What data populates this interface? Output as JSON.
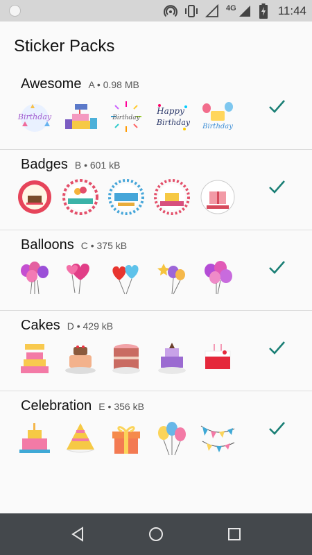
{
  "status_bar": {
    "time": "11:44",
    "network": "4G",
    "icons": [
      "app-notification-icon",
      "hotspot-icon",
      "vibrate-icon",
      "no-signal-icon",
      "signal-icon",
      "battery-charging-icon"
    ]
  },
  "app_bar": {
    "title": "Sticker Packs"
  },
  "packs": [
    {
      "name": "Awesome",
      "meta": "A • 0.98 MB",
      "stickers": [
        "happy-birthday-to-you-sticker",
        "happy-birthday-gifts-cake-sticker",
        "birthday-burst-sticker",
        "happy-birthday-script-sticker",
        "happy-birthday-balloons-sticker"
      ]
    },
    {
      "name": "Badges",
      "meta": "B • 601 kB",
      "stickers": [
        "cake-badge-sticker",
        "happy-birthday-ribbon-badge-sticker",
        "happy-birthday-scalloped-badge-sticker",
        "birthday-cake-badge-sticker",
        "happy-birthday-gift-badge-sticker"
      ]
    },
    {
      "name": "Balloons",
      "meta": "C • 375 kB",
      "stickers": [
        "balloon-bunch-sticker",
        "heart-balloons-sticker",
        "red-blue-heart-balloons-sticker",
        "star-balloons-sticker",
        "purple-balloons-sticker"
      ]
    },
    {
      "name": "Cakes",
      "meta": "D • 429 kB",
      "stickers": [
        "happy-birthday-cake-sticker",
        "chocolate-cake-sticker",
        "pink-cake-sticker",
        "purple-layer-cake-sticker",
        "candle-cake-sticker"
      ]
    },
    {
      "name": "Celebration",
      "meta": "E • 356 kB",
      "stickers": [
        "birthday-cake-sticker",
        "party-hat-sticker",
        "gift-box-sticker",
        "balloons-sticker",
        "bunting-flags-sticker"
      ]
    }
  ],
  "colors": {
    "check": "#1a7f75",
    "status_bar": "#d6d6d6",
    "nav_bar": "#44484c",
    "divider": "#dcdcdc"
  },
  "nav_bar": {
    "icons": [
      "back-icon",
      "home-icon",
      "recents-icon"
    ]
  }
}
